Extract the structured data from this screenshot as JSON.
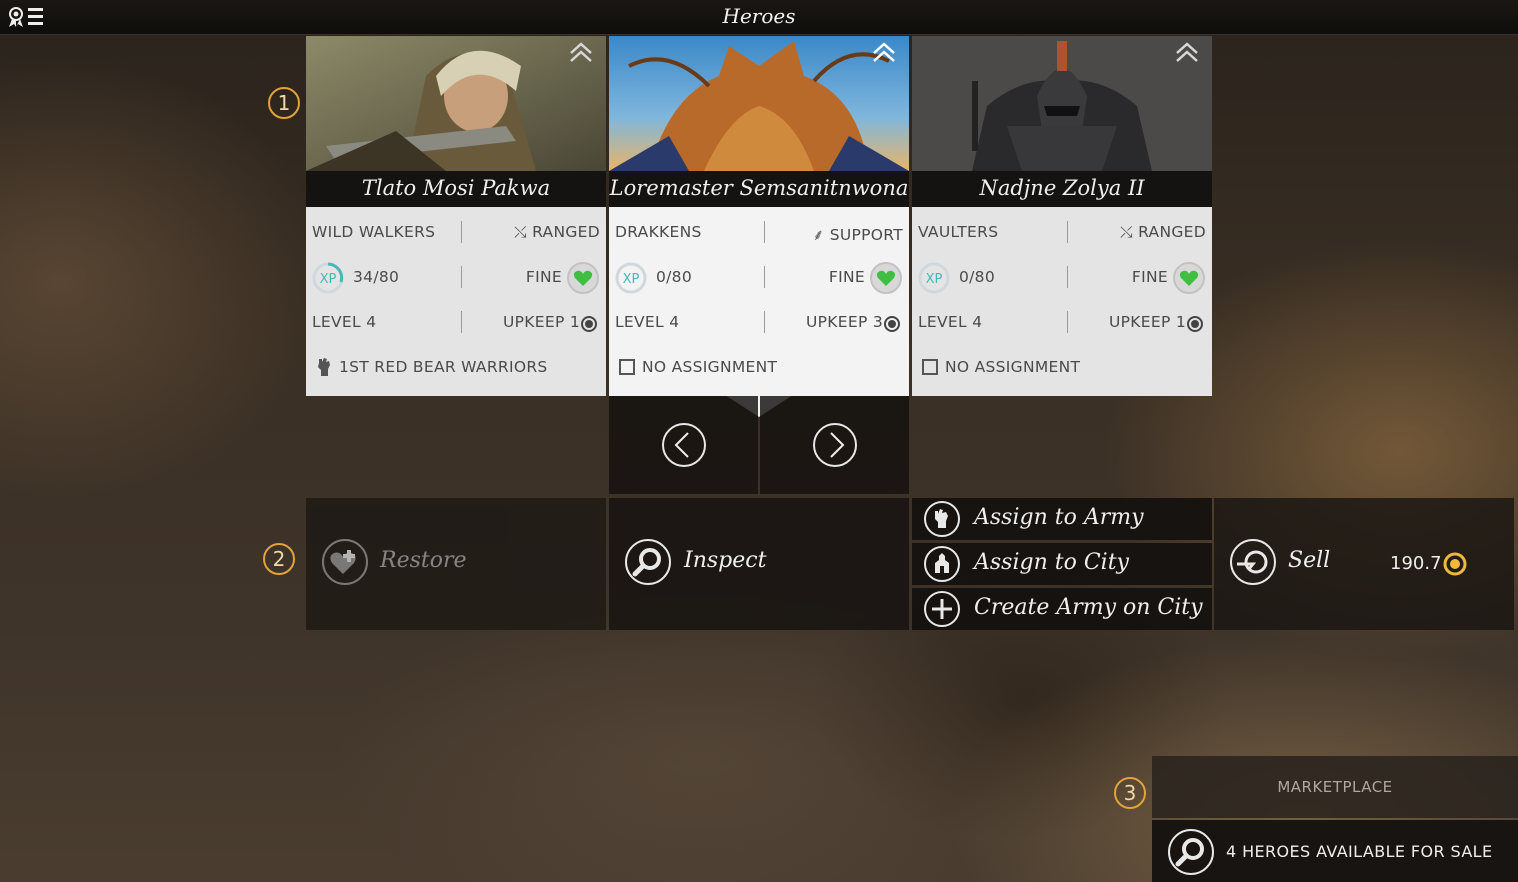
{
  "header": {
    "title": "Heroes",
    "menu_icon": "medal-list-icon"
  },
  "heroes": [
    {
      "name": "Tlato Mosi Pakwa",
      "faction": "WILD WALKERS",
      "role": "RANGED",
      "xp": "34/80",
      "xp_fraction": 0.425,
      "health": "FINE",
      "level": "LEVEL 4",
      "upkeep": "UPKEEP 1",
      "assignment": "1ST RED BEAR WARRIORS",
      "selected": false
    },
    {
      "name": "Loremaster Semsanitnwona",
      "faction": "DRAKKENS",
      "role": "SUPPORT",
      "xp": "0/80",
      "xp_fraction": 0,
      "health": "FINE",
      "level": "LEVEL 4",
      "upkeep": "UPKEEP 3",
      "assignment": "NO ASSIGNMENT",
      "selected": true
    },
    {
      "name": "Nadjne Zolya II",
      "faction": "VAULTERS",
      "role": "RANGED",
      "xp": "0/80",
      "xp_fraction": 0,
      "health": "FINE",
      "level": "LEVEL 4",
      "upkeep": "UPKEEP 1",
      "assignment": "NO ASSIGNMENT",
      "selected": false
    }
  ],
  "xp_label": "XP",
  "actions": {
    "restore": "Restore",
    "inspect": "Inspect",
    "assign_army": "Assign to Army",
    "assign_city": "Assign to City",
    "create_army": "Create Army on City",
    "sell": "Sell",
    "sell_price": "190.7"
  },
  "markers": [
    "1",
    "2",
    "3"
  ],
  "marketplace": {
    "title": "MARKETPLACE",
    "text": "4 HEROES AVAILABLE FOR SALE"
  },
  "colors": {
    "accent": "#e2a33b",
    "health": "#3fbf3f",
    "xp": "#4bb"
  }
}
